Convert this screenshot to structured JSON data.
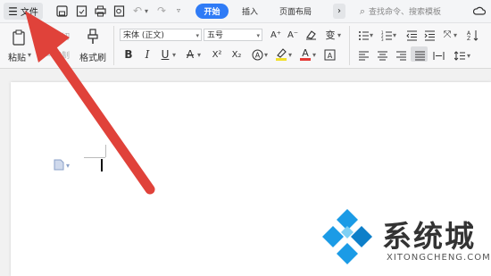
{
  "topbar": {
    "menu_label": "文件",
    "tabs": [
      "开始",
      "插入",
      "页面布局"
    ],
    "search_placeholder": "查找命令、搜索模板"
  },
  "ribbon": {
    "paste": "粘贴",
    "cut": "剪切",
    "copy": "复制",
    "format_painter": "格式刷",
    "font_name": "宋体 (正文)",
    "font_size": "五号",
    "bold": "B",
    "italic": "I",
    "underline": "U",
    "strike": "A",
    "superscript": "X²",
    "subscript": "X₂",
    "font_grow": "A⁺",
    "font_shrink": "A⁻",
    "phonetic": "变"
  },
  "watermark": {
    "brand": "系统城",
    "url": "XITONGCHENG.COM"
  },
  "colors": {
    "accent": "#2f7bf6",
    "arrow": "#e0423a",
    "logo_blue": "#1b9be6"
  }
}
